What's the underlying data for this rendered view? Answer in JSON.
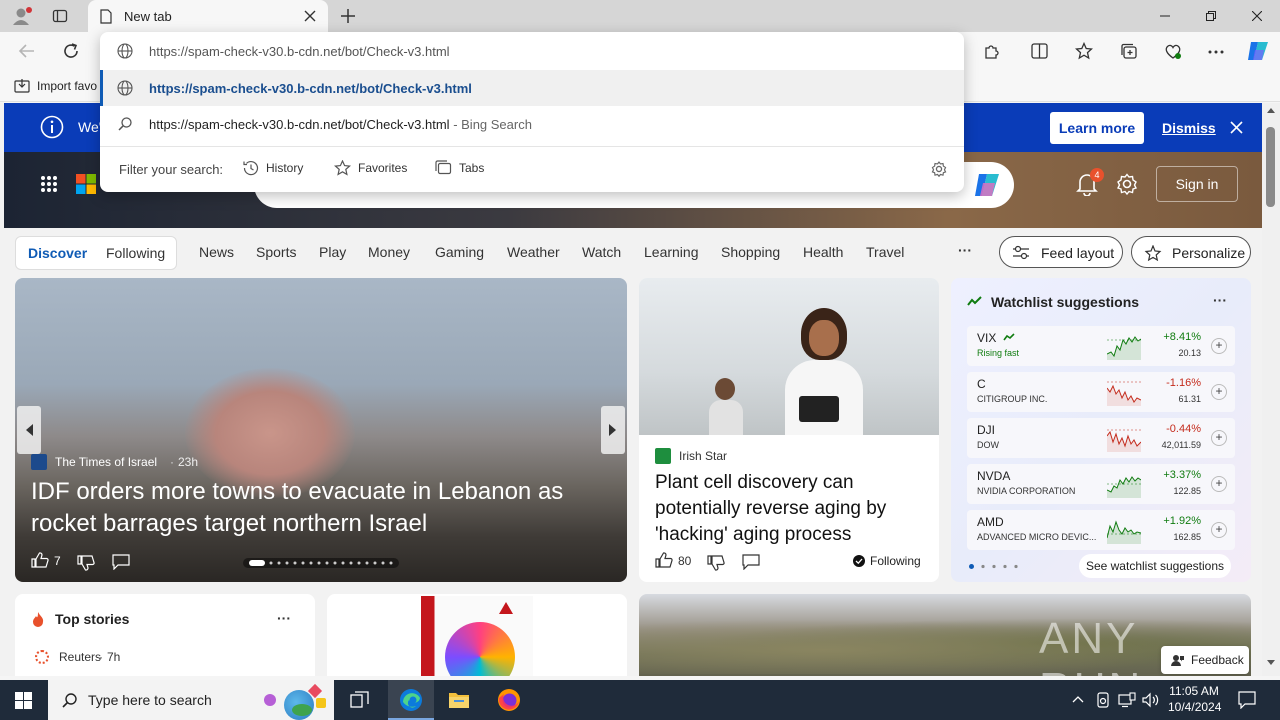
{
  "browser": {
    "tab_title": "New tab",
    "address_value": "https://spam-check-v30.b-cdn.net/bot/Check-v3.html",
    "import_favorites": "Import favo"
  },
  "dropdown": {
    "suggestion_url": "https://spam-check-v30.b-cdn.net/bot/Check-v3.html",
    "search_text": "https://spam-check-v30.b-cdn.net/bot/Check-v3.html",
    "search_suffix": " - Bing Search",
    "filter_label": "Filter your search:",
    "filter_history": "History",
    "filter_favorites": "Favorites",
    "filter_tabs": "Tabs"
  },
  "infobar": {
    "text_fragment": "We'",
    "learn_more": "Learn more",
    "dismiss": "Dismiss"
  },
  "header": {
    "notification_count": "4",
    "sign_in": "Sign in"
  },
  "nav": {
    "discover": "Discover",
    "following": "Following",
    "items": [
      "News",
      "Sports",
      "Play",
      "Money",
      "Gaming",
      "Weather",
      "Watch",
      "Learning",
      "Shopping",
      "Health",
      "Travel"
    ],
    "more": "···",
    "feed_layout": "Feed layout",
    "personalize": "Personalize"
  },
  "main_story": {
    "source": "The Times of Israel",
    "age": "23h",
    "headline": "IDF orders more towns to evacuate in Lebanon as rocket barrages target northern Israel",
    "likes": "7"
  },
  "second_story": {
    "source": "Irish Star",
    "headline": "Plant cell discovery can potentially reverse aging by 'hacking' aging process",
    "likes": "80",
    "following": "Following"
  },
  "watchlist": {
    "title": "Watchlist suggestions",
    "menu": "···",
    "see_more": "See watchlist suggestions",
    "items": [
      {
        "symbol": "VIX",
        "name": "Rising fast",
        "change": "+8.41%",
        "price": "20.13",
        "trend": "up"
      },
      {
        "symbol": "C",
        "name": "CITIGROUP INC.",
        "change": "-1.16%",
        "price": "61.31",
        "trend": "down"
      },
      {
        "symbol": "DJI",
        "name": "DOW",
        "change": "-0.44%",
        "price": "42,011.59",
        "trend": "down"
      },
      {
        "symbol": "NVDA",
        "name": "NVIDIA CORPORATION",
        "change": "+3.37%",
        "price": "122.85",
        "trend": "up"
      },
      {
        "symbol": "AMD",
        "name": "ADVANCED MICRO DEVIC...",
        "change": "+1.92%",
        "price": "162.85",
        "trend": "up"
      }
    ]
  },
  "top_stories": {
    "title": "Top stories",
    "menu": "···",
    "source": "Reuters",
    "age": "7h"
  },
  "feedback": "Feedback",
  "watermark": "ANY RUN",
  "taskbar": {
    "search_placeholder": "Type here to search",
    "time": "11:05 AM",
    "date": "10/4/2024"
  }
}
